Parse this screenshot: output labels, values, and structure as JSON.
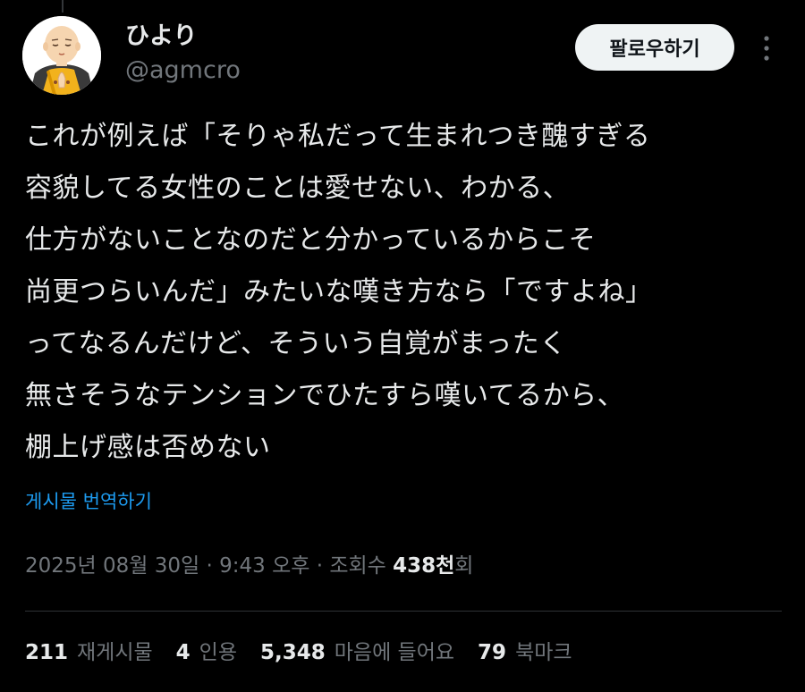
{
  "author": {
    "display_name": "ひより",
    "handle": "@agmcro"
  },
  "header": {
    "follow_label": "팔로우하기",
    "more_icon": "more-vertical-icon"
  },
  "tweet": {
    "lines": [
      "これが例えば「そりゃ私だって生まれつき醜すぎる",
      "容貌してる女性のことは愛せない、わかる、",
      "仕方がないことなのだと分かっているからこそ",
      "尚更つらいんだ」みたいな嘆き方なら「ですよね」",
      "ってなるんだけど、そういう自覚がまったく",
      "無さそうなテンションでひたすら嘆いてるから、",
      "棚上げ感は否めない"
    ],
    "translate_label": "게시물 번역하기"
  },
  "meta": {
    "date": "2025년 08월 30일",
    "separator": " · ",
    "time": "9:43 오후",
    "views_prefix": "조회수 ",
    "views_count": "438천",
    "views_suffix": "회"
  },
  "stats": {
    "reposts_count": "211",
    "reposts_label": "재게시물",
    "quotes_count": "4",
    "quotes_label": "인용",
    "likes_count": "5,348",
    "likes_label": "마음에 들어요",
    "bookmarks_count": "79",
    "bookmarks_label": "북마크"
  },
  "colors": {
    "background": "#000000",
    "text_primary": "#e7e9ea",
    "text_secondary": "#71767b",
    "link": "#1d9bf0",
    "button_bg": "#eff3f4",
    "divider": "#2f3336"
  }
}
